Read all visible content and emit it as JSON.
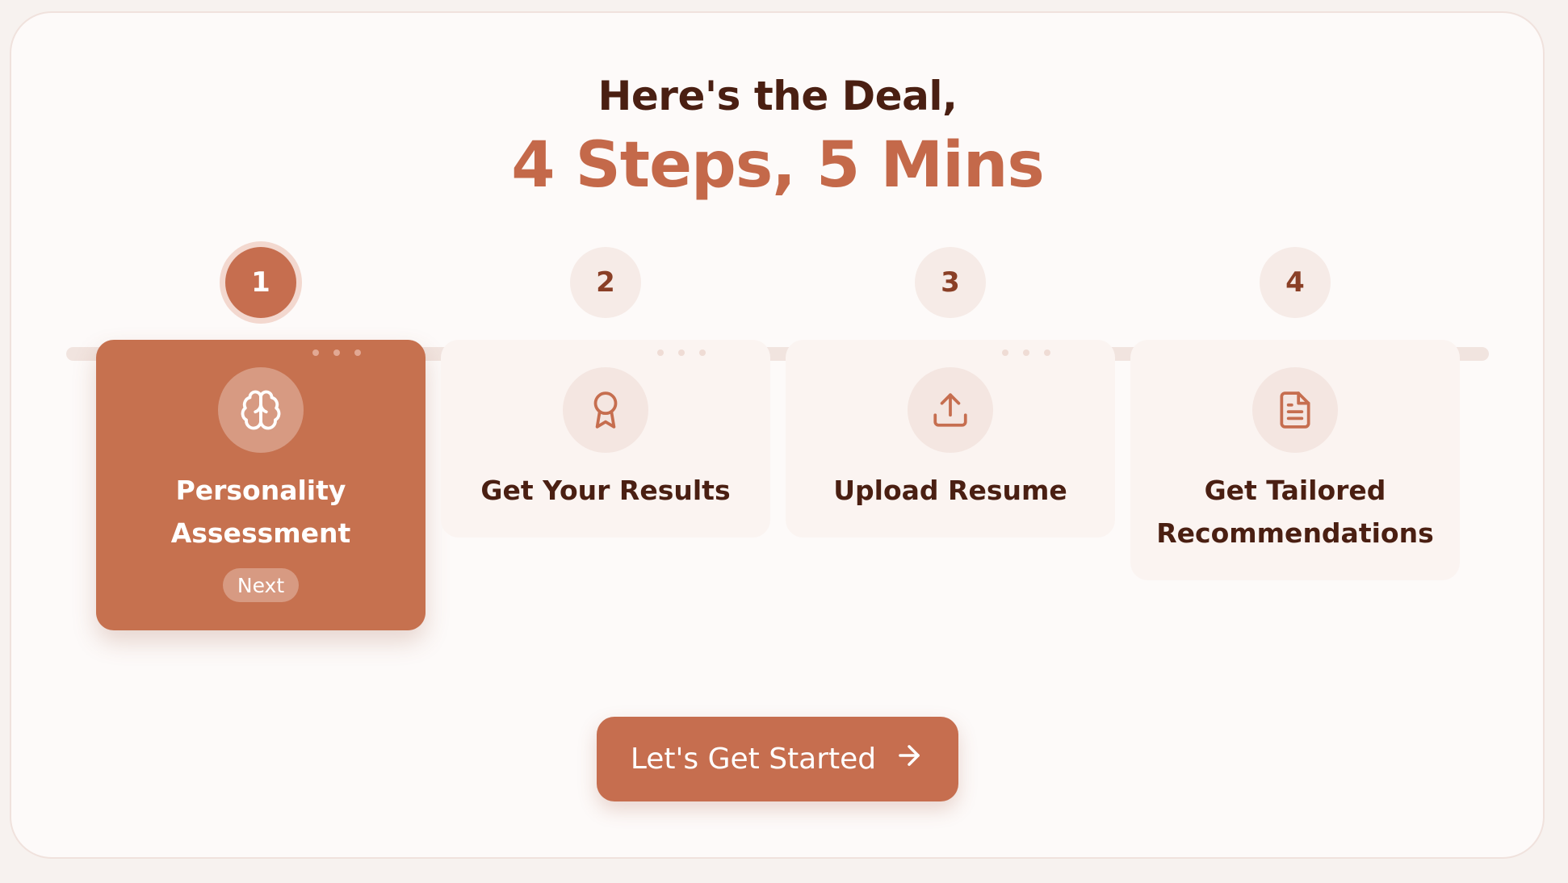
{
  "header": {
    "line1": "Here's the Deal,",
    "line2": "4 Steps, 5 Mins"
  },
  "steps": [
    {
      "number": "1",
      "title": "Personality Assessment",
      "title_lines": [
        "Personality",
        "Assessment"
      ],
      "icon": "brain-icon",
      "badge": "Next",
      "active": true
    },
    {
      "number": "2",
      "title": "Get Your Results",
      "title_lines": [
        "Get Your Results"
      ],
      "icon": "award-icon",
      "active": false
    },
    {
      "number": "3",
      "title": "Upload Resume",
      "title_lines": [
        "Upload Resume"
      ],
      "icon": "upload-icon",
      "active": false
    },
    {
      "number": "4",
      "title": "Get Tailored Recommendations",
      "title_lines": [
        "Get Tailored",
        "Recommendations"
      ],
      "icon": "document-icon",
      "active": false
    }
  ],
  "cta": {
    "label": "Let's Get Started",
    "icon": "arrow-right-icon"
  },
  "colors": {
    "accent": "#c66e4f",
    "heading_dark": "#4a1f12",
    "background": "#fdfaf9"
  }
}
